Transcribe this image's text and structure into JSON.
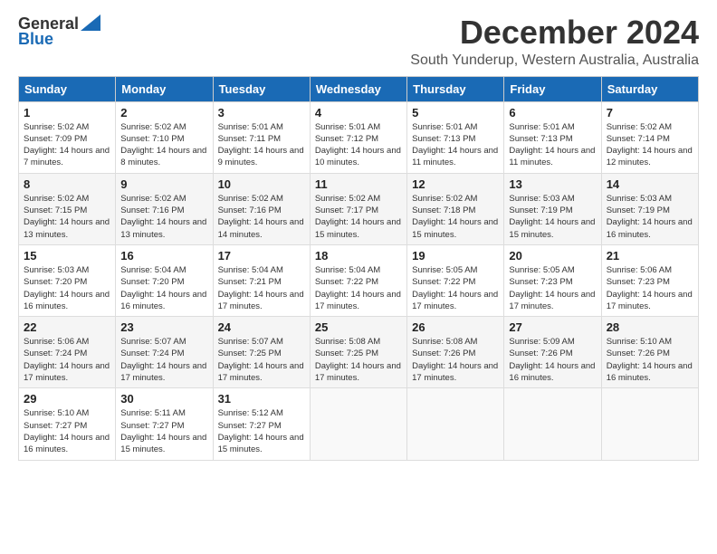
{
  "logo": {
    "general": "General",
    "blue": "Blue"
  },
  "title": "December 2024",
  "location": "South Yunderup, Western Australia, Australia",
  "days_of_week": [
    "Sunday",
    "Monday",
    "Tuesday",
    "Wednesday",
    "Thursday",
    "Friday",
    "Saturday"
  ],
  "weeks": [
    [
      {
        "day": "1",
        "sunrise": "5:02 AM",
        "sunset": "7:09 PM",
        "daylight": "14 hours and 7 minutes."
      },
      {
        "day": "2",
        "sunrise": "5:02 AM",
        "sunset": "7:10 PM",
        "daylight": "14 hours and 8 minutes."
      },
      {
        "day": "3",
        "sunrise": "5:01 AM",
        "sunset": "7:11 PM",
        "daylight": "14 hours and 9 minutes."
      },
      {
        "day": "4",
        "sunrise": "5:01 AM",
        "sunset": "7:12 PM",
        "daylight": "14 hours and 10 minutes."
      },
      {
        "day": "5",
        "sunrise": "5:01 AM",
        "sunset": "7:13 PM",
        "daylight": "14 hours and 11 minutes."
      },
      {
        "day": "6",
        "sunrise": "5:01 AM",
        "sunset": "7:13 PM",
        "daylight": "14 hours and 11 minutes."
      },
      {
        "day": "7",
        "sunrise": "5:02 AM",
        "sunset": "7:14 PM",
        "daylight": "14 hours and 12 minutes."
      }
    ],
    [
      {
        "day": "8",
        "sunrise": "5:02 AM",
        "sunset": "7:15 PM",
        "daylight": "14 hours and 13 minutes."
      },
      {
        "day": "9",
        "sunrise": "5:02 AM",
        "sunset": "7:16 PM",
        "daylight": "14 hours and 13 minutes."
      },
      {
        "day": "10",
        "sunrise": "5:02 AM",
        "sunset": "7:16 PM",
        "daylight": "14 hours and 14 minutes."
      },
      {
        "day": "11",
        "sunrise": "5:02 AM",
        "sunset": "7:17 PM",
        "daylight": "14 hours and 15 minutes."
      },
      {
        "day": "12",
        "sunrise": "5:02 AM",
        "sunset": "7:18 PM",
        "daylight": "14 hours and 15 minutes."
      },
      {
        "day": "13",
        "sunrise": "5:03 AM",
        "sunset": "7:19 PM",
        "daylight": "14 hours and 15 minutes."
      },
      {
        "day": "14",
        "sunrise": "5:03 AM",
        "sunset": "7:19 PM",
        "daylight": "14 hours and 16 minutes."
      }
    ],
    [
      {
        "day": "15",
        "sunrise": "5:03 AM",
        "sunset": "7:20 PM",
        "daylight": "14 hours and 16 minutes."
      },
      {
        "day": "16",
        "sunrise": "5:04 AM",
        "sunset": "7:20 PM",
        "daylight": "14 hours and 16 minutes."
      },
      {
        "day": "17",
        "sunrise": "5:04 AM",
        "sunset": "7:21 PM",
        "daylight": "14 hours and 17 minutes."
      },
      {
        "day": "18",
        "sunrise": "5:04 AM",
        "sunset": "7:22 PM",
        "daylight": "14 hours and 17 minutes."
      },
      {
        "day": "19",
        "sunrise": "5:05 AM",
        "sunset": "7:22 PM",
        "daylight": "14 hours and 17 minutes."
      },
      {
        "day": "20",
        "sunrise": "5:05 AM",
        "sunset": "7:23 PM",
        "daylight": "14 hours and 17 minutes."
      },
      {
        "day": "21",
        "sunrise": "5:06 AM",
        "sunset": "7:23 PM",
        "daylight": "14 hours and 17 minutes."
      }
    ],
    [
      {
        "day": "22",
        "sunrise": "5:06 AM",
        "sunset": "7:24 PM",
        "daylight": "14 hours and 17 minutes."
      },
      {
        "day": "23",
        "sunrise": "5:07 AM",
        "sunset": "7:24 PM",
        "daylight": "14 hours and 17 minutes."
      },
      {
        "day": "24",
        "sunrise": "5:07 AM",
        "sunset": "7:25 PM",
        "daylight": "14 hours and 17 minutes."
      },
      {
        "day": "25",
        "sunrise": "5:08 AM",
        "sunset": "7:25 PM",
        "daylight": "14 hours and 17 minutes."
      },
      {
        "day": "26",
        "sunrise": "5:08 AM",
        "sunset": "7:26 PM",
        "daylight": "14 hours and 17 minutes."
      },
      {
        "day": "27",
        "sunrise": "5:09 AM",
        "sunset": "7:26 PM",
        "daylight": "14 hours and 16 minutes."
      },
      {
        "day": "28",
        "sunrise": "5:10 AM",
        "sunset": "7:26 PM",
        "daylight": "14 hours and 16 minutes."
      }
    ],
    [
      {
        "day": "29",
        "sunrise": "5:10 AM",
        "sunset": "7:27 PM",
        "daylight": "14 hours and 16 minutes."
      },
      {
        "day": "30",
        "sunrise": "5:11 AM",
        "sunset": "7:27 PM",
        "daylight": "14 hours and 15 minutes."
      },
      {
        "day": "31",
        "sunrise": "5:12 AM",
        "sunset": "7:27 PM",
        "daylight": "14 hours and 15 minutes."
      },
      null,
      null,
      null,
      null
    ]
  ],
  "labels": {
    "sunrise": "Sunrise:",
    "sunset": "Sunset:",
    "daylight": "Daylight:"
  }
}
